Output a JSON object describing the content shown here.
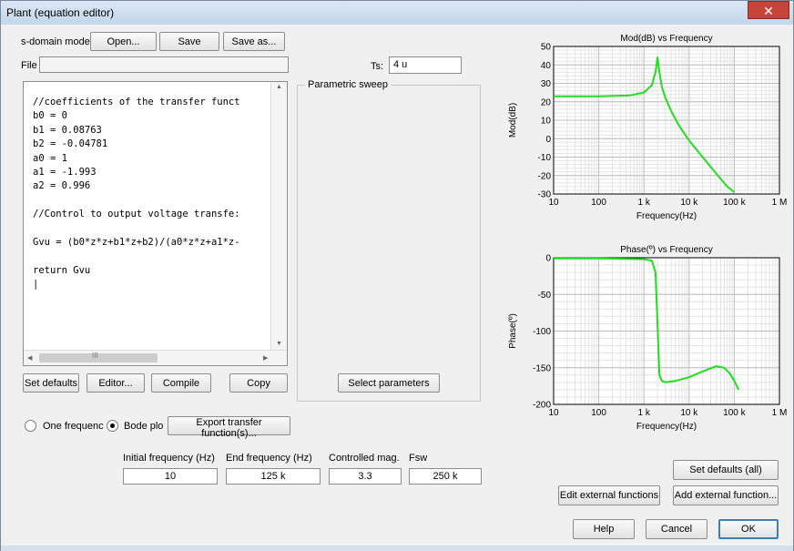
{
  "window": {
    "title": "Plant (equation editor)",
    "close_glyph": "✕"
  },
  "model": {
    "label": "s-domain model",
    "open_label": "Open...",
    "save_label": "Save",
    "save_as_label": "Save as...",
    "file_label": "File",
    "file_value": "",
    "ts_label": "Ts:",
    "ts_value": "4 u"
  },
  "editor": {
    "code": "//coefficients of the transfer funct\nb0 = 0\nb1 = 0.08763\nb2 = -0.04781\na0 = 1\na1 = -1.993\na2 = 0.996\n\n//Control to output voltage transfe:\n\nGvu = (b0*z*z+b1*z+b2)/(a0*z*z+a1*z-\n\nreturn Gvu\n|",
    "scroll_glyph": "III"
  },
  "buttons": {
    "set_defaults": "Set defaults",
    "editor": "Editor...",
    "compile": "Compile",
    "copy": "Copy",
    "select_parameters": "Select parameters",
    "export": "Export transfer function(s)...",
    "set_defaults_all": "Set defaults (all)",
    "edit_external": "Edit external functions",
    "add_external": "Add external function...",
    "help": "Help",
    "cancel": "Cancel",
    "ok": "OK"
  },
  "sweep": {
    "legend": "Parametric sweep"
  },
  "mode": {
    "one_freq_label": "One frequenc",
    "bode_label": "Bode plo",
    "selected": "bode"
  },
  "params": {
    "initial_freq_label": "Initial frequency (Hz)",
    "initial_freq_value": "10",
    "end_freq_label": "End frequency (Hz)",
    "end_freq_value": "125 k",
    "controlled_mag_label": "Controlled mag.",
    "controlled_mag_value": "3.3",
    "fsw_label": "Fsw",
    "fsw_value": "250 k"
  },
  "chart_data": [
    {
      "type": "line",
      "title": "Mod(dB) vs Frequency",
      "xlabel": "Frequency(Hz)",
      "ylabel": "Mod(dB)",
      "xscale": "log",
      "xlim": [
        10,
        1000000
      ],
      "ylim": [
        -30,
        50
      ],
      "xticks": [
        10,
        100,
        1000,
        10000,
        100000,
        1000000
      ],
      "xtick_labels": [
        "10",
        "100",
        "1 k",
        "10 k",
        "100 k",
        "1 M"
      ],
      "yticks": [
        50,
        40,
        30,
        20,
        10,
        0,
        -10,
        -20,
        -30
      ],
      "ytick_labels": [
        "50",
        "40",
        "30",
        "20",
        "10",
        "0",
        "-10",
        "-20",
        "-30"
      ],
      "grid": true,
      "color": "#22dd22",
      "series": [
        {
          "x": [
            10,
            100,
            500,
            1000,
            1500,
            1800,
            2000,
            2200,
            2500,
            3000,
            4000,
            6000,
            10000,
            20000,
            40000,
            70000,
            100000
          ],
          "y": [
            23,
            23,
            23.5,
            25,
            29,
            36,
            44,
            36,
            28,
            22,
            15,
            7,
            -1,
            -10,
            -19,
            -26,
            -29
          ]
        }
      ]
    },
    {
      "type": "line",
      "title": "Phase(º) vs Frequency",
      "xlabel": "Frequency(Hz)",
      "ylabel": "Phase(º)",
      "xscale": "log",
      "xlim": [
        10,
        1000000
      ],
      "ylim": [
        -200,
        0
      ],
      "xticks": [
        10,
        100,
        1000,
        10000,
        100000,
        1000000
      ],
      "xtick_labels": [
        "10",
        "100",
        "1 k",
        "10 k",
        "100 k",
        "1 M"
      ],
      "yticks": [
        0,
        -50,
        -100,
        -150,
        -200
      ],
      "ytick_labels": [
        "0",
        "-50",
        "-100",
        "-150",
        "-200"
      ],
      "grid": true,
      "color": "#22dd22",
      "series": [
        {
          "x": [
            10,
            100,
            1000,
            1500,
            1800,
            2000,
            2200,
            2500,
            3000,
            5000,
            10000,
            20000,
            40000,
            60000,
            80000,
            100000,
            125000
          ],
          "y": [
            -1,
            -1,
            -2,
            -4,
            -20,
            -90,
            -160,
            -168,
            -170,
            -168,
            -163,
            -155,
            -148,
            -150,
            -158,
            -168,
            -180
          ]
        }
      ]
    }
  ]
}
